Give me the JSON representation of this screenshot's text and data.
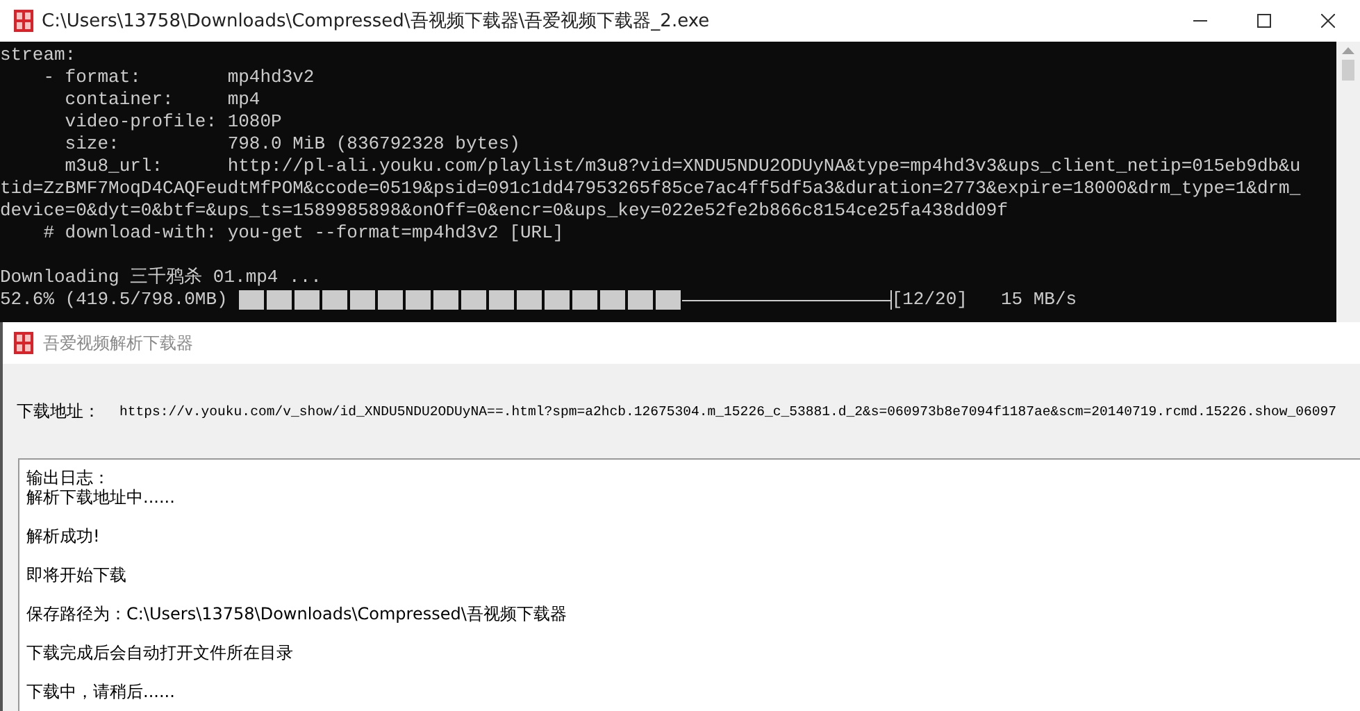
{
  "console_window": {
    "title": "C:\\Users\\13758\\Downloads\\Compressed\\吾视频下载器\\吾爱视频下载器_2.exe",
    "lines": [
      "stream:",
      "    - format:        mp4hd3v2",
      "      container:     mp4",
      "      video-profile: 1080P",
      "      size:          798.0 MiB (836792328 bytes)",
      "      m3u8_url:      http://pl-ali.youku.com/playlist/m3u8?vid=XNDU5NDU2ODUyNA&type=mp4hd3v3&ups_client_netip=015eb9db&u",
      "tid=ZzBMF7MoqD4CAQFeudtMfPOM&ccode=0519&psid=091c1dd47953265f85ce7ac4ff5df5a3&duration=2773&expire=18000&drm_type=1&drm_",
      "device=0&dyt=0&btf=&ups_ts=1589985898&onOff=0&encr=0&ups_key=022e52fe2b866c8154ce25fa438dd09f",
      "    # download-with: you-get --format=mp4hd3v2 [URL]"
    ],
    "status": "Downloading 三千鸦杀 01.mp4 ...",
    "progress": {
      "percent_text": "52.6% (419.5/798.0MB)",
      "level": 0.68,
      "count": "[12/20]",
      "speed": "15 MB/s"
    }
  },
  "app_window": {
    "title": "吾爱视频解析下载器",
    "url_label": "下载地址：",
    "url": "https://v.youku.com/v_show/id_XNDU5NDU2ODUyNA==.html?spm=a2hcb.12675304.m_15226_c_53881.d_2&s=060973b8e7094f1187ae&scm=20140719.rcmd.15226.show_06097",
    "log_header": "输出日志：",
    "log_entries": [
      "解析下载地址中......",
      "解析成功!",
      "即将开始下载",
      "保存路径为：C:\\Users\\13758\\Downloads\\Compressed\\吾视频下载器",
      "下载完成后会自动打开文件所在目录",
      "下载中，请稍后......"
    ]
  }
}
